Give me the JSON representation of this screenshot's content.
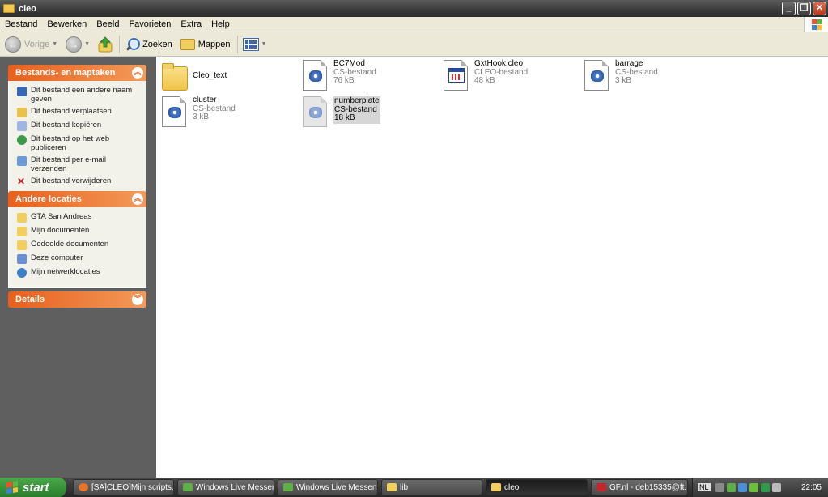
{
  "window": {
    "title": "cleo"
  },
  "menu": [
    "Bestand",
    "Bewerken",
    "Beeld",
    "Favorieten",
    "Extra",
    "Help"
  ],
  "toolbar": {
    "back": "Vorige",
    "search": "Zoeken",
    "folders": "Mappen"
  },
  "tasks_panel": {
    "title": "Bestands- en maptaken",
    "items": [
      "Dit bestand een andere naam geven",
      "Dit bestand verplaatsen",
      "Dit bestand kopiëren",
      "Dit bestand op het web publiceren",
      "Dit bestand per e-mail verzenden",
      "Dit bestand verwijderen"
    ]
  },
  "places_panel": {
    "title": "Andere locaties",
    "items": [
      "GTA San Andreas",
      "Mijn documenten",
      "Gedeelde documenten",
      "Deze computer",
      "Mijn netwerklocaties"
    ]
  },
  "details_panel": {
    "title": "Details"
  },
  "files": [
    {
      "name": "Cleo_text",
      "type": "",
      "size": ""
    },
    {
      "name": "BC7Mod",
      "type": "CS-bestand",
      "size": "76 kB"
    },
    {
      "name": "GxtHook.cleo",
      "type": "CLEO-bestand",
      "size": "48 kB"
    },
    {
      "name": "barrage",
      "type": "CS-bestand",
      "size": "3 kB"
    },
    {
      "name": "cluster",
      "type": "CS-bestand",
      "size": "3 kB"
    },
    {
      "name": "numberplate",
      "type": "CS-bestand",
      "size": "18 kB"
    }
  ],
  "taskbar": {
    "start": "start",
    "buttons": [
      "[SA]CLEO]Mijn scripts...",
      "Windows Live Messen...",
      "Windows Live Messen...",
      "lib",
      "cleo",
      "GF.nl - deb15335@ft..."
    ],
    "lang": "NL",
    "clock": "22:05"
  }
}
